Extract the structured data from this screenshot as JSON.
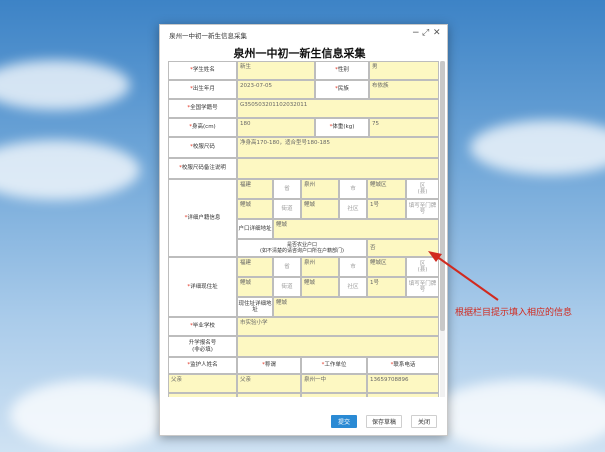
{
  "window": {
    "title": "泉州一中初一新生信息采集"
  },
  "form": {
    "title": "泉州一中初一新生信息采集",
    "labels": {
      "name": "学生姓名",
      "gender": "性别",
      "birth": "出生年月",
      "ethnicity": "民族",
      "student_id": "全国学籍号",
      "height": "身高(cm)",
      "weight": "体重(kg)",
      "uniform_size": "校服尺码",
      "uniform_note": "校服尺码备注说明",
      "huji": "详细户籍信息",
      "huji_detail": "户口详细地址",
      "nongye": "是否农业户口\n(如不清楚的请咨询户口所在户籍部门)",
      "residence": "详细现住址",
      "res_detail": "现住址详细地址",
      "school": "毕业学校",
      "report_no": "升学报名号\n(非必填)",
      "guardian_name": "监护人姓名",
      "relation": "称谓",
      "workplace": "工作单位",
      "phone": "联系电话",
      "province": "省",
      "city": "市",
      "district": "区\n(县)",
      "street": "街道",
      "community": "社区",
      "house_no": "填写至门牌号"
    },
    "values": {
      "name": "新生",
      "gender": "男",
      "birth": "2023-07-05",
      "ethnicity": "布依族",
      "student_id": "G350503201102032011",
      "height": "180",
      "weight": "75",
      "uniform_size": "净身高170-180，适合型号180-185",
      "uniform_note": "",
      "huji_province": "福建",
      "huji_city": "泉州",
      "huji_district": "鲤城区",
      "huji_street": "鲤城",
      "huji_community": "鲤城",
      "huji_house": "1号",
      "huji_detail": "鲤城",
      "nongye": "否",
      "res_province": "福建",
      "res_city": "泉州",
      "res_district": "鲤城区",
      "res_street": "鲤城",
      "res_community": "鲤城",
      "res_house": "1号",
      "res_detail": "鲤城",
      "school": "市实验小学",
      "report_no": "",
      "guardian_name": "父亲",
      "relation": "父亲",
      "workplace": "泉州一中",
      "phone": "13659708896"
    }
  },
  "buttons": {
    "submit": "提交",
    "save_draft": "保存草稿",
    "close": "关闭"
  },
  "annotation": {
    "text": "根据栏目提示填入相应的信息"
  },
  "colors": {
    "input_bg": "#fdf8c2",
    "required": "#e0301e",
    "primary": "#2a8ad4",
    "annotation": "#d12a1f"
  }
}
